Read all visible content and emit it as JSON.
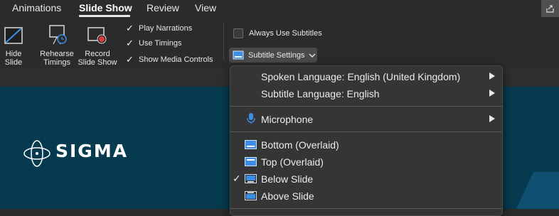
{
  "tabs": [
    {
      "label": "Animations",
      "active": false
    },
    {
      "label": "Slide Show",
      "active": true
    },
    {
      "label": "Review",
      "active": false
    },
    {
      "label": "View",
      "active": false
    }
  ],
  "ribbon": {
    "hide_slide": [
      "Hide",
      "Slide"
    ],
    "rehearse_timings": [
      "Rehearse",
      "Timings"
    ],
    "record_slide_show": [
      "Record",
      "Slide Show"
    ],
    "checks": [
      {
        "label": "Play Narrations",
        "checked": true
      },
      {
        "label": "Use Timings",
        "checked": true
      },
      {
        "label": "Show Media Controls",
        "checked": true
      }
    ],
    "always_use_subtitles": {
      "label": "Always Use Subtitles",
      "checked": false
    },
    "subtitle_settings_label": "Subtitle Settings"
  },
  "slide": {
    "logo_text": "SIGMA"
  },
  "menu": {
    "spoken_language": "Spoken Language: English (United Kingdom)",
    "subtitle_language": "Subtitle Language: English",
    "microphone": "Microphone",
    "positions": [
      {
        "label": "Bottom (Overlaid)",
        "checked": false
      },
      {
        "label": "Top (Overlaid)",
        "checked": false
      },
      {
        "label": "Below Slide",
        "checked": true
      },
      {
        "label": "Above Slide",
        "checked": false
      }
    ]
  },
  "colors": {
    "accent_blue": "#3a8ee6",
    "record_red": "#e0393e",
    "slide_bg": "#063a4e"
  }
}
